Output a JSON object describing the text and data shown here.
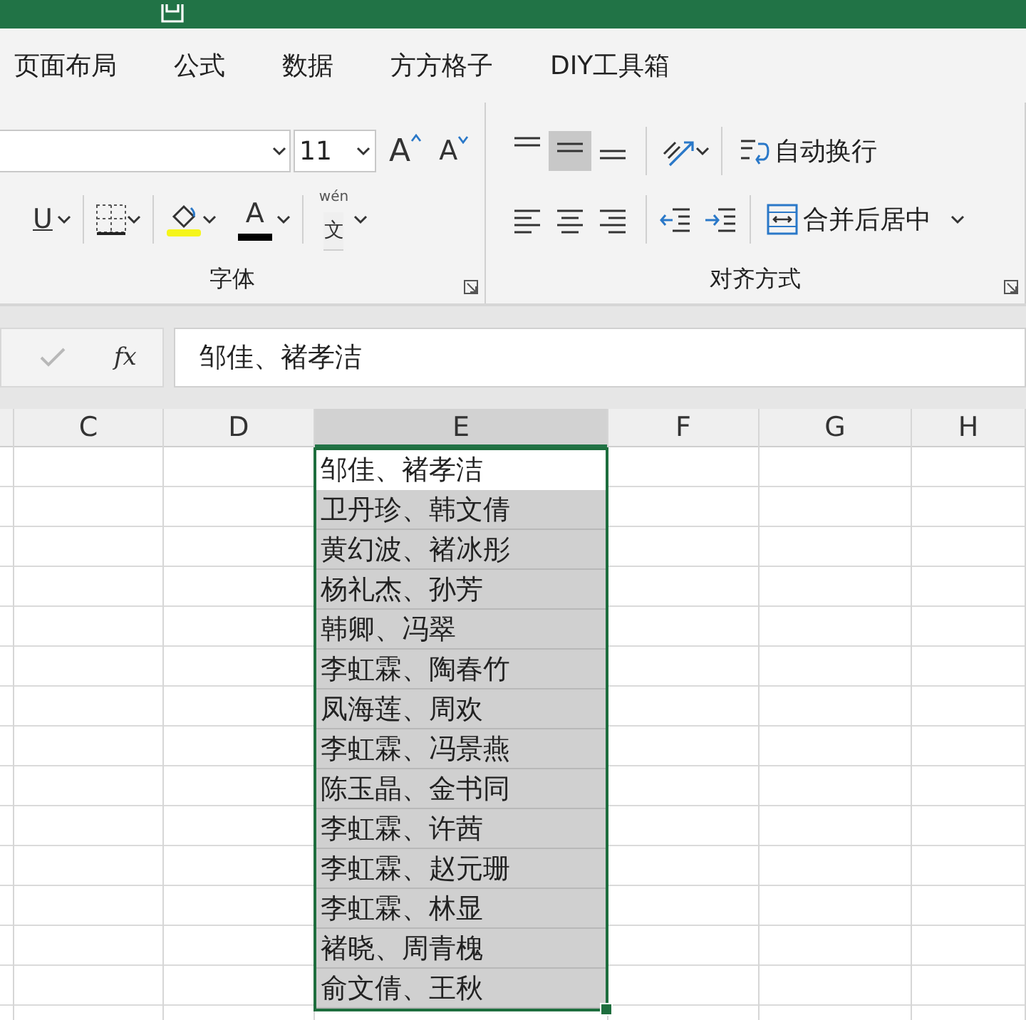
{
  "ribbon_tabs": [
    {
      "label": "页面布局",
      "selected": false
    },
    {
      "label": "公式",
      "selected": false
    },
    {
      "label": "数据",
      "selected": false
    },
    {
      "label": "方方格子",
      "selected": false
    },
    {
      "label": "DIY工具箱",
      "selected": false
    }
  ],
  "font_group": {
    "label": "字体",
    "font_size": "11",
    "grow_font": "A",
    "shrink_font": "A",
    "underline": "U",
    "font_color": "A",
    "phonetic_pinyin": "wén",
    "phonetic_char": "文"
  },
  "alignment_group": {
    "label": "对齐方式",
    "vertical_align": [
      {
        "kind": "top",
        "selected": false
      },
      {
        "kind": "middle",
        "selected": true
      },
      {
        "kind": "bottom",
        "selected": false
      }
    ],
    "horizontal_align": [
      {
        "kind": "left",
        "selected": false
      },
      {
        "kind": "center",
        "selected": false
      },
      {
        "kind": "right",
        "selected": false
      }
    ],
    "wrap_text": "自动换行",
    "merge_center": "合并后居中"
  },
  "formula_bar": {
    "fx": "fx",
    "value": "邹佳、褚孝洁"
  },
  "columns": [
    {
      "label": "C",
      "selected": false
    },
    {
      "label": "D",
      "selected": false
    },
    {
      "label": "E",
      "selected": true
    },
    {
      "label": "F",
      "selected": false
    },
    {
      "label": "G",
      "selected": false
    },
    {
      "label": "H",
      "selected": false
    }
  ],
  "cells": [
    {
      "text": "邹佳、褚孝洁",
      "active": true
    },
    {
      "text": "卫丹珍、韩文倩",
      "active": false
    },
    {
      "text": "黄幻波、褚冰彤",
      "active": false
    },
    {
      "text": "杨礼杰、孙芳",
      "active": false
    },
    {
      "text": "韩卿、冯翠",
      "active": false
    },
    {
      "text": "李虹霖、陶春竹",
      "active": false
    },
    {
      "text": "凤海莲、周欢",
      "active": false
    },
    {
      "text": "李虹霖、冯景燕",
      "active": false
    },
    {
      "text": "陈玉晶、金书同",
      "active": false
    },
    {
      "text": "李虹霖、许茜",
      "active": false
    },
    {
      "text": "李虹霖、赵元珊",
      "active": false
    },
    {
      "text": "李虹霖、林显",
      "active": false
    },
    {
      "text": "褚晓、周青槐",
      "active": false
    },
    {
      "text": "俞文倩、王秋",
      "active": false
    }
  ]
}
